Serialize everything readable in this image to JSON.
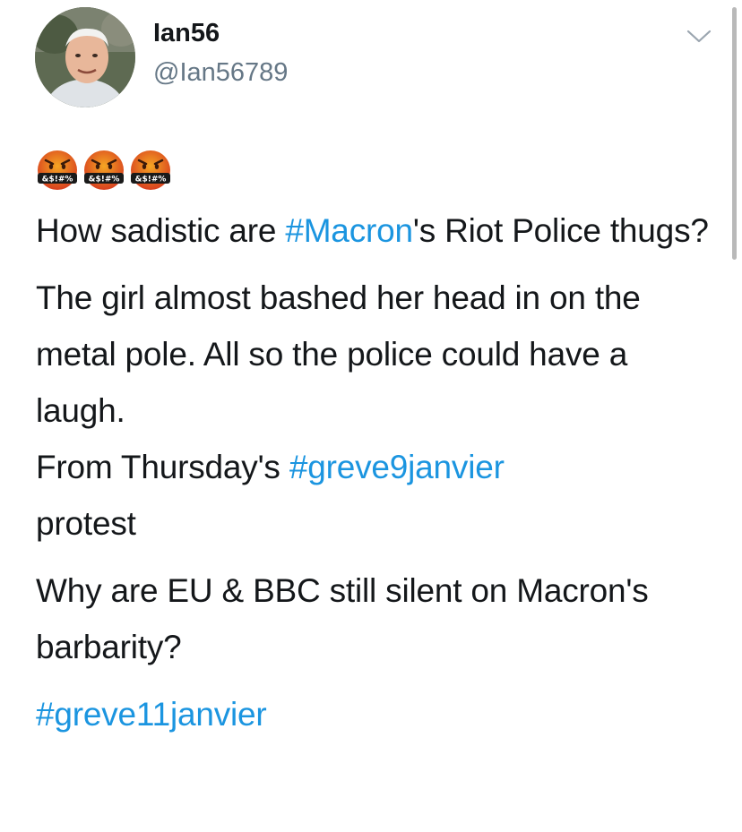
{
  "author": {
    "display_name": "Ian56",
    "handle": "@Ian56789"
  },
  "emojis": {
    "name": "face-with-symbols-on-mouth-icon",
    "glyph_text": "&$!#%",
    "count": 3
  },
  "tweet": {
    "p1": {
      "pre": "How sadistic are ",
      "hashtag": "#Macron",
      "post": "'s Riot Police thugs?"
    },
    "p2": {
      "text": "The girl almost bashed her head in on the metal pole. All so the police could have a laugh."
    },
    "p3": {
      "pre": "From Thursday's ",
      "hashtag": "#greve9janvier",
      "post": "protest"
    },
    "p4": {
      "text": "Why are EU & BBC still silent on Macron's barbarity?"
    },
    "p5": {
      "hashtag": "#greve11janvier"
    }
  },
  "colors": {
    "link": "#1b95e0",
    "text": "#14171a",
    "secondary": "#657786",
    "emoji_face": "#e8512b"
  }
}
